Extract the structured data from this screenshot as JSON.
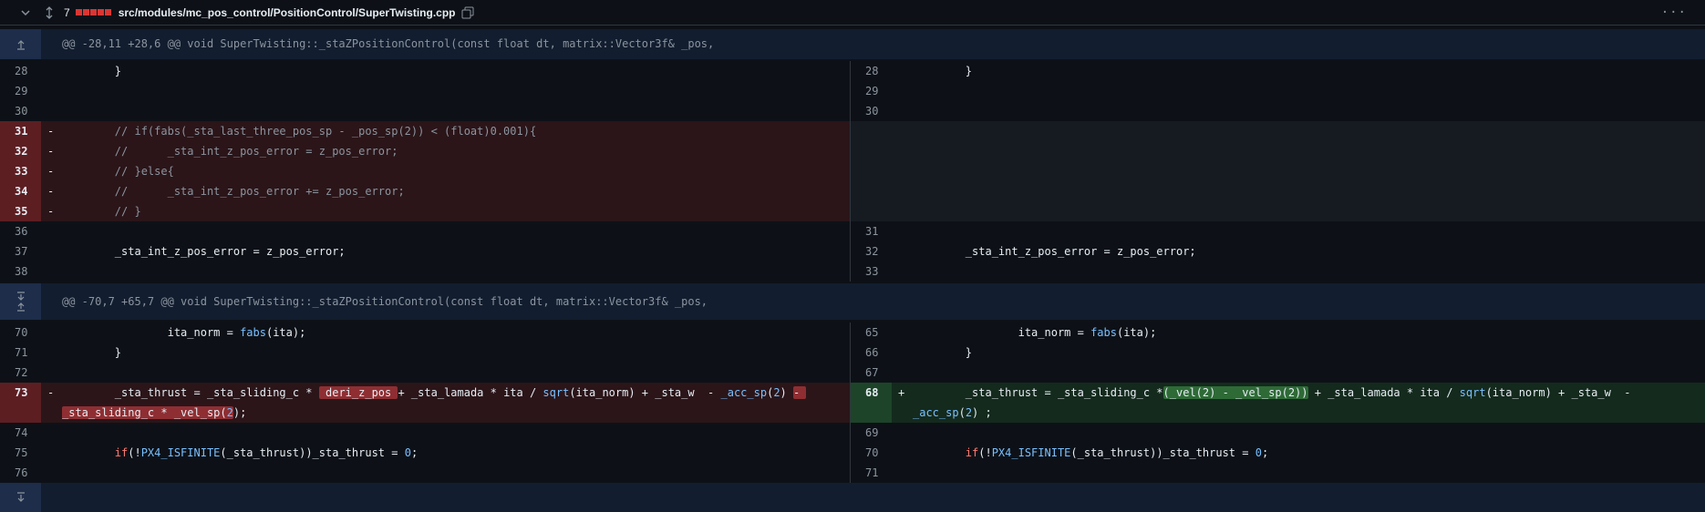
{
  "file": {
    "changes_count": "7",
    "diffstat_colors": [
      "#da3633",
      "#da3633",
      "#da3633",
      "#da3633",
      "#da3633"
    ],
    "path": "src/modules/mc_pos_control/PositionControl/SuperTwisting.cpp",
    "more_label": "···"
  },
  "hunks": [
    {
      "header": "@@ -28,11 +28,6 @@ void SuperTwisting::_staZPositionControl(const float dt, matrix::Vector3f& _pos,"
    },
    {
      "header": "@@ -70,7 +65,7 @@ void SuperTwisting::_staZPositionControl(const float dt, matrix::Vector3f& _pos,"
    }
  ],
  "lines": {
    "l28": {
      "num": "28",
      "code": "        }"
    },
    "l29": {
      "num": "29"
    },
    "l30": {
      "num": "30"
    },
    "l31": {
      "num": "31",
      "mark": "-",
      "code": "        // if(fabs(_sta_last_three_pos_sp - _pos_sp(2)) < (float)0.001){"
    },
    "l32": {
      "num": "32",
      "mark": "-",
      "code": "        //      _sta_int_z_pos_error = z_pos_error;"
    },
    "l33": {
      "num": "33",
      "mark": "-",
      "code": "        // }else{"
    },
    "l34": {
      "num": "34",
      "mark": "-",
      "code": "        //      _sta_int_z_pos_error += z_pos_error;"
    },
    "l35": {
      "num": "35",
      "mark": "-",
      "code": "        // }"
    },
    "l36": {
      "num": "36"
    },
    "l37": {
      "num": "37",
      "code": "        _sta_int_z_pos_error = z_pos_error;"
    },
    "l38": {
      "num": "38"
    },
    "r28": {
      "num": "28",
      "code": "        }"
    },
    "r29": {
      "num": "29"
    },
    "r30": {
      "num": "30"
    },
    "r31": {
      "num": "31"
    },
    "r32": {
      "num": "32",
      "code": "        _sta_int_z_pos_error = z_pos_error;"
    },
    "r33": {
      "num": "33"
    },
    "l70": {
      "num": "70",
      "code_a": "                ita_norm = ",
      "fn": "fabs",
      "code_b": "(ita);"
    },
    "l71": {
      "num": "71",
      "code": "        }"
    },
    "l72": {
      "num": "72"
    },
    "l73": {
      "num": "73",
      "mark": "-",
      "p1": "        _sta_thrust = _sta_sliding_c * ",
      "h1": " deri_z_pos ",
      "p2": "+ _sta_lamada * ita / ",
      "fn": "sqrt",
      "p3": "(ita_norm) + _sta_w  - ",
      "fn2": "_acc_sp",
      "p4": "(",
      "n1": "2",
      "p5": ") ",
      "h2": "- ",
      "w1": "_sta_sliding_c * _vel_sp(",
      "n2": "2",
      "w2": ");"
    },
    "l74": {
      "num": "74"
    },
    "l75": {
      "num": "75",
      "kw": "if",
      "c1": "(!",
      "mac": "PX4_ISFINITE",
      "c2": "(_sta_thrust))_sta_thrust = ",
      "n": "0",
      "c3": ";"
    },
    "l76": {
      "num": "76"
    },
    "r65": {
      "num": "65",
      "code_a": "                ita_norm = ",
      "fn": "fabs",
      "code_b": "(ita);"
    },
    "r66": {
      "num": "66",
      "code": "        }"
    },
    "r67": {
      "num": "67"
    },
    "r68": {
      "num": "68",
      "mark": "+",
      "p1": "        _sta_thrust = _sta_sliding_c *",
      "h1": "(_vel(2) - _vel_sp(2))",
      "p2": " + _sta_lamada * ita / ",
      "fn": "sqrt",
      "p3": "(ita_norm) + _sta_w  -",
      "fn2": "_acc_sp",
      "p4": "(",
      "n1": "2",
      "p5": ") ;"
    },
    "r69": {
      "num": "69"
    },
    "r70": {
      "num": "70",
      "kw": "if",
      "c1": "(!",
      "mac": "PX4_ISFINITE",
      "c2": "(_sta_thrust))_sta_thrust = ",
      "n": "0",
      "c3": ";"
    },
    "r71": {
      "num": "71"
    }
  }
}
